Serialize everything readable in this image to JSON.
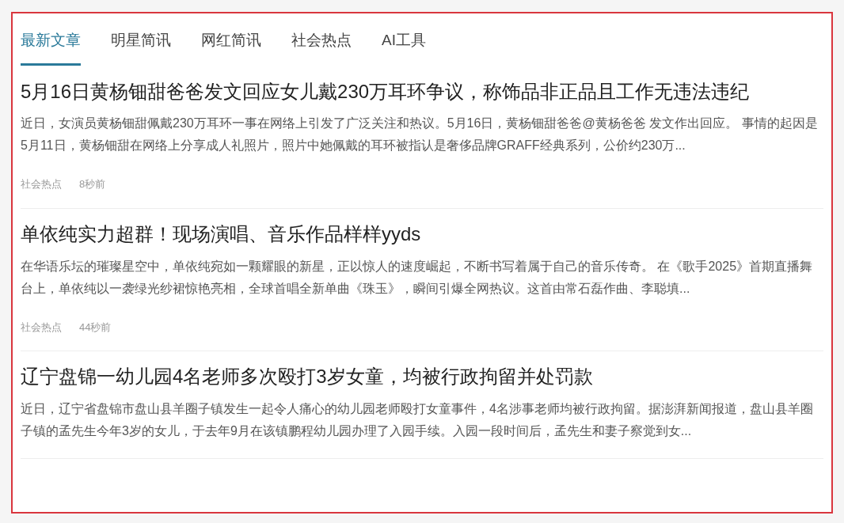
{
  "tabs": [
    {
      "label": "最新文章",
      "selected": true
    },
    {
      "label": "明星简讯",
      "selected": false
    },
    {
      "label": "网红简讯",
      "selected": false
    },
    {
      "label": "社会热点",
      "selected": false
    },
    {
      "label": "AI工具",
      "selected": false
    }
  ],
  "articles": [
    {
      "title": "5月16日黄杨钿甜爸爸发文回应女儿戴230万耳环争议，称饰品非正品且工作无违法违纪",
      "excerpt": "近日，女演员黄杨钿甜佩戴230万耳环一事在网络上引发了广泛关注和热议。5月16日，黄杨钿甜爸爸@黄杨爸爸 发文作出回应。 事情的起因是5月11日，黄杨钿甜在网络上分享成人礼照片，照片中她佩戴的耳环被指认是奢侈品牌GRAFF经典系列，公价约230万...",
      "category": "社会热点",
      "time": "8秒前"
    },
    {
      "title": "单依纯实力超群！现场演唱、音乐作品样样yyds",
      "excerpt": "在华语乐坛的璀璨星空中，单依纯宛如一颗耀眼的新星，正以惊人的速度崛起，不断书写着属于自己的音乐传奇。 在《歌手2025》首期直播舞台上，单依纯以一袭绿光纱裙惊艳亮相，全球首唱全新单曲《珠玉》，瞬间引爆全网热议。这首由常石磊作曲、李聪填...",
      "category": "社会热点",
      "time": "44秒前"
    },
    {
      "title": "辽宁盘锦一幼儿园4名老师多次殴打3岁女童，均被行政拘留并处罚款",
      "excerpt": "近日，辽宁省盘锦市盘山县羊圈子镇发生一起令人痛心的幼儿园老师殴打女童事件，4名涉事老师均被行政拘留。据澎湃新闻报道，盘山县羊圈子镇的孟先生今年3岁的女儿，于去年9月在该镇鹏程幼儿园办理了入园手续。入园一段时间后，孟先生和妻子察觉到女..."
    }
  ]
}
